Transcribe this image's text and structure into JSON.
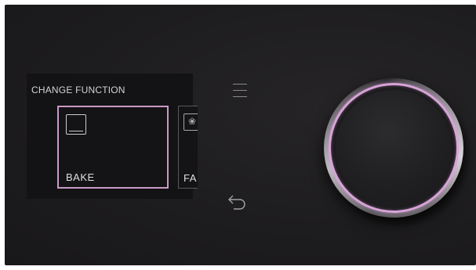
{
  "screen": {
    "title": "CHANGE FUNCTION",
    "functions": [
      {
        "label": "BAKE",
        "icon": "bake-icon",
        "selected": true
      },
      {
        "label": "FA",
        "icon": "fan-icon",
        "selected": false
      }
    ]
  },
  "controls": {
    "menu_icon": "menu-icon",
    "back_icon": "back-arrow-icon",
    "knob": "control-knob"
  },
  "colors": {
    "accent": "#d7a3d8",
    "background": "#1d1c1e",
    "text": "#e2dfe4"
  }
}
